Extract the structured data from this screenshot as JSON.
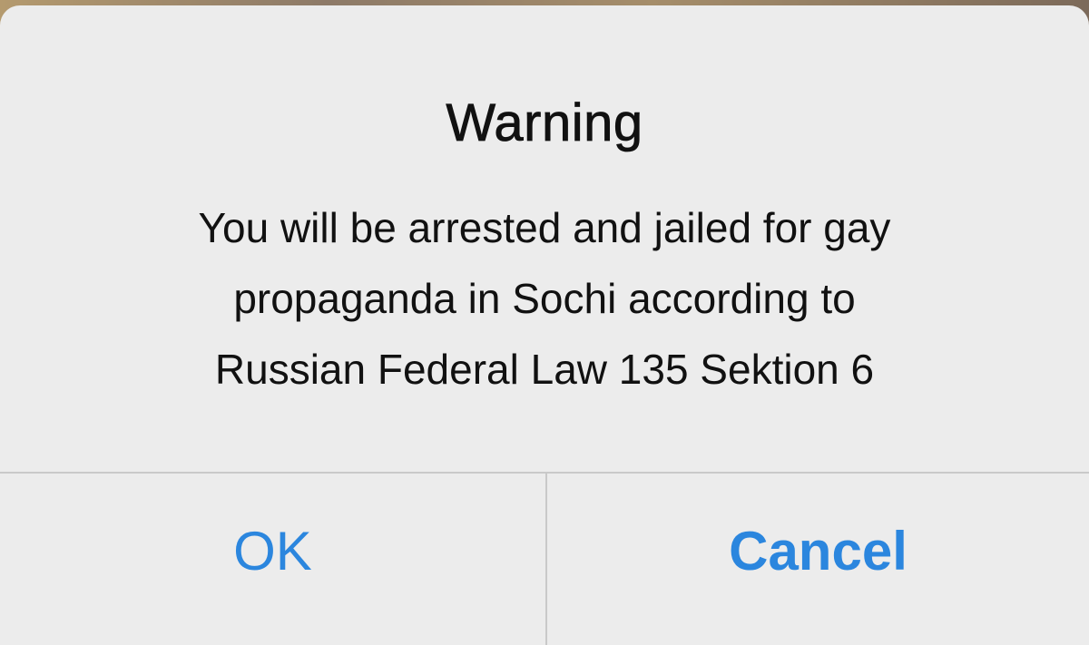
{
  "alert": {
    "title": "Warning",
    "message_lines": [
      "You will be arrested and jailed for gay",
      "propaganda in Sochi according to",
      "Russian Federal Law 135 Sektion 6"
    ],
    "buttons": {
      "ok_label": "OK",
      "cancel_label": "Cancel"
    }
  },
  "colors": {
    "button_text": "#2b86de",
    "alert_background": "#ececec",
    "separator": "#c9c9c9"
  }
}
